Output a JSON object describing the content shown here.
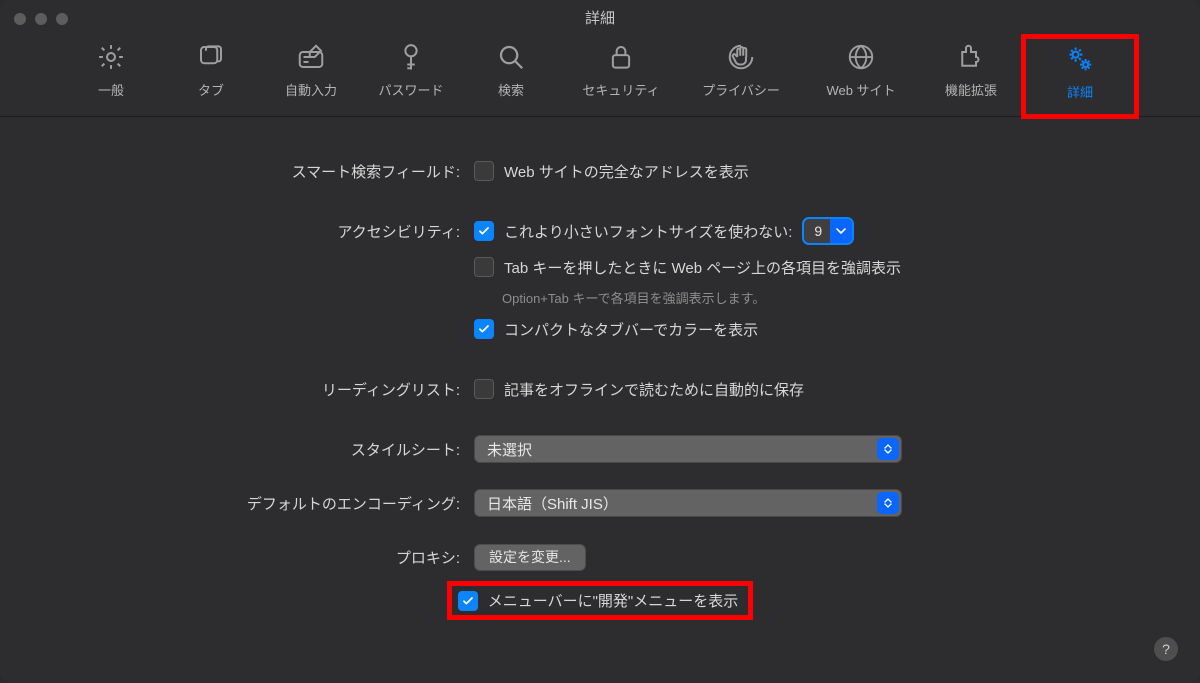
{
  "window": {
    "title": "詳細"
  },
  "toolbar": {
    "items": [
      {
        "label": "一般"
      },
      {
        "label": "タブ"
      },
      {
        "label": "自動入力"
      },
      {
        "label": "パスワード"
      },
      {
        "label": "検索"
      },
      {
        "label": "セキュリティ"
      },
      {
        "label": "プライバシー"
      },
      {
        "label": "Web サイト"
      },
      {
        "label": "機能拡張"
      },
      {
        "label": "詳細"
      }
    ]
  },
  "sections": {
    "smart_search": {
      "label": "スマート検索フィールド:",
      "show_full_url": {
        "checked": false,
        "text": "Web サイトの完全なアドレスを表示"
      }
    },
    "accessibility": {
      "label": "アクセシビリティ:",
      "min_font": {
        "checked": true,
        "text": "これより小さいフォントサイズを使わない:",
        "value": "9"
      },
      "tab_highlight": {
        "checked": false,
        "text": "Tab キーを押したときに Web ページ上の各項目を強調表示"
      },
      "tab_hint": "Option+Tab キーで各項目を強調表示します。",
      "compact_color": {
        "checked": true,
        "text": "コンパクトなタブバーでカラーを表示"
      }
    },
    "reading_list": {
      "label": "リーディングリスト:",
      "offline": {
        "checked": false,
        "text": "記事をオフラインで読むために自動的に保存"
      }
    },
    "stylesheet": {
      "label": "スタイルシート:",
      "value": "未選択"
    },
    "encoding": {
      "label": "デフォルトのエンコーディング:",
      "value": "日本語（Shift JIS）"
    },
    "proxy": {
      "label": "プロキシ:",
      "button": "設定を変更..."
    },
    "develop": {
      "checked": true,
      "text": "メニューバーに\"開発\"メニューを表示"
    }
  },
  "help": "?"
}
